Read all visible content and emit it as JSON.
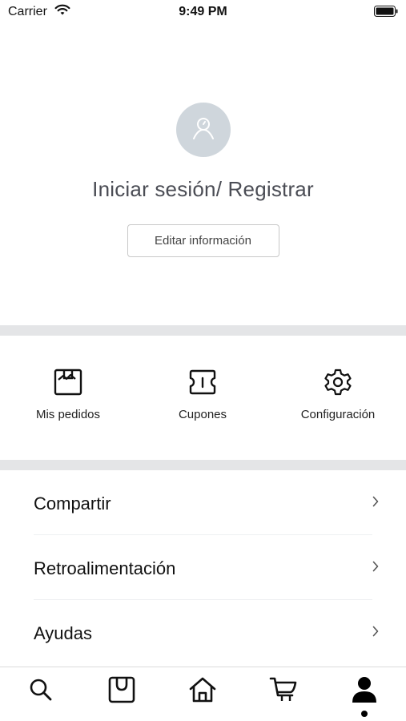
{
  "status_bar": {
    "carrier": "Carrier",
    "time": "9:49 PM"
  },
  "profile": {
    "login_label": "Iniciar sesión/ Registrar",
    "edit_button": "Editar información"
  },
  "quick_actions": [
    {
      "label": "Mis pedidos",
      "icon": "orders-icon"
    },
    {
      "label": "Cupones",
      "icon": "coupon-icon"
    },
    {
      "label": "Configuración",
      "icon": "settings-gear-icon"
    }
  ],
  "menu": [
    {
      "label": "Compartir"
    },
    {
      "label": "Retroalimentación"
    },
    {
      "label": "Ayudas"
    }
  ],
  "tab_bar": {
    "tabs": [
      "search-icon",
      "bag-icon",
      "home-icon",
      "cart-icon",
      "profile-icon"
    ],
    "active": "profile-icon"
  },
  "colors": {
    "divider": "#e4e5e7",
    "avatar_bg": "#cfd6dc",
    "text_muted": "#4b4d55"
  }
}
